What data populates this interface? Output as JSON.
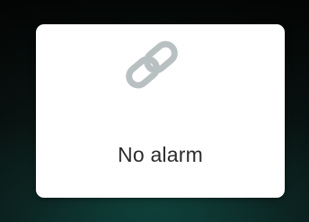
{
  "card": {
    "icon": "link-icon",
    "label": "No alarm"
  },
  "colors": {
    "background_top": "#050807",
    "background_bottom": "#123a35",
    "card": "#ffffff",
    "icon": "#b9c0c2",
    "text": "#2b2b2b"
  }
}
